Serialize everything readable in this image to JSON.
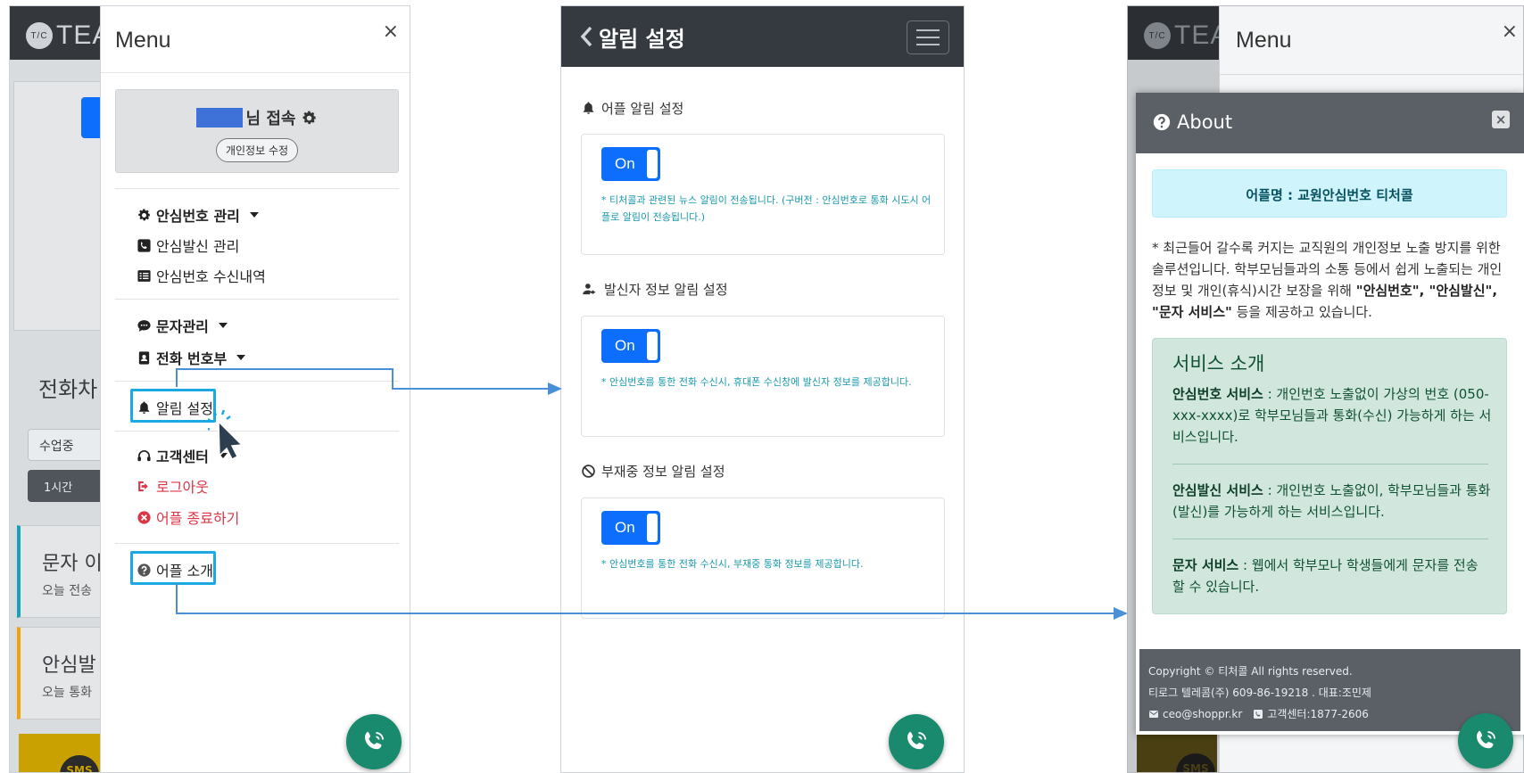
{
  "panel1": {
    "bg_logo": "TEA",
    "bg_logo_badge": "T/C",
    "bg_title": "전화차",
    "bg_select": "수업중",
    "bg_btn": "1시간",
    "bg_card1_title": "문자 이",
    "bg_card1_sub": "오늘 전송",
    "bg_card2_title": "안심발",
    "bg_card2_sub": "오늘 통화",
    "bg_sms": "SMS",
    "menu": {
      "title": "Menu",
      "close": "×",
      "user_suffix": "님 접속",
      "edit_profile": "개인정보 수정",
      "items": [
        {
          "label": "안심번호 관리",
          "icon": "gear-icon"
        },
        {
          "label": "안심발신 관리",
          "icon": "phone-square-icon"
        },
        {
          "label": "안심번호 수신내역",
          "icon": "list-icon"
        },
        {
          "label": "문자관리",
          "icon": "sms-icon"
        },
        {
          "label": "전화 번호부",
          "icon": "contact-book-icon"
        },
        {
          "label": "알림 설정",
          "icon": "bell-icon"
        },
        {
          "label": "고객센터",
          "icon": "headset-icon"
        },
        {
          "label": "로그아웃",
          "icon": "sign-out-icon"
        },
        {
          "label": "어플 종료하기",
          "icon": "times-circle-icon"
        },
        {
          "label": "어플 소개",
          "icon": "question-circle-icon"
        }
      ]
    }
  },
  "panel2": {
    "title": "알림 설정",
    "sections": [
      {
        "title": "어플 알림 설정",
        "toggle": "On",
        "desc": "* 티처콜과 관련된 뉴스 알림이 전송됩니다. (구버전 : 안심번호로 통화 시도시 어플로 알림이 전송됩니다.)"
      },
      {
        "title": "발신자 정보 알림 설정",
        "toggle": "On",
        "desc": "* 안심번호를 통한 전화 수신시, 휴대폰 수신창에 발신자 정보를 제공합니다."
      },
      {
        "title": "부재중 정보 알림 설정",
        "toggle": "On",
        "desc": "* 안심번호를 통한 전화 수신시, 부재중 통화 정보를 제공합니다."
      }
    ]
  },
  "panel3": {
    "bg_menu_title": "Menu",
    "bg_close": "×",
    "modal": {
      "title": "About",
      "close": "×",
      "app_name": "어플명 : 교원안심번호 티처콜",
      "intro_1": "* 최근들어 갈수록 커지는 교직원의 개인정보 노출 방지를 위한 솔루션입니다. 학부모님들과의 소통 등에서 쉽게 노출되는 개인정보 및 개인(휴식)시간 보장을 위해 ",
      "intro_b1": "\"안심번호\", \"안심발신\", \"문자 서비스\"",
      "intro_2": " 등을 제공하고 있습니다.",
      "service_title": "서비스 소개",
      "services": [
        {
          "name": "안심번호 서비스",
          "desc": " : 개인번호 노출없이 가상의 번호 (050-xxx-xxxx)로 학부모님들과 통화(수신) 가능하게 하는 서비스입니다."
        },
        {
          "name": "안심발신 서비스",
          "desc": " : 개인번호 노출없이, 학부모님들과 통화(발신)를 가능하게 하는 서비스입니다."
        },
        {
          "name": "문자 서비스",
          "desc": " : 웹에서 학부모나 학생들에게 문자를 전송 할 수 있습니다."
        }
      ],
      "footer": {
        "copyright": "Copyright © 티처콜 All rights reserved.",
        "company": "티로그 텔레콤(주) 609-86-19218 . 대표:조민제",
        "email": "ceo@shoppr.kr",
        "center": "고객센터:1877-2606"
      }
    }
  },
  "colors": {
    "header_dark": "#343a40",
    "highlight": "#1ca8e0",
    "arrow": "#4a90d9",
    "toggle_on": "#0d6efd",
    "fab": "#1a8a6e",
    "danger": "#dc3545"
  }
}
